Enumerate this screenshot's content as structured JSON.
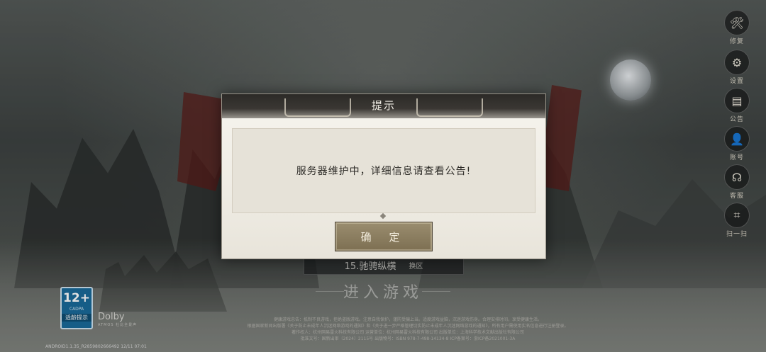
{
  "dialog": {
    "title": "提示",
    "message": "服务器维护中，详细信息请查看公告!",
    "confirm_label": "确 定"
  },
  "side_menu": [
    {
      "icon": "wrench-icon",
      "glyph": "🛠",
      "label": "修复"
    },
    {
      "icon": "gear-icon",
      "glyph": "⚙",
      "label": "设置"
    },
    {
      "icon": "notice-icon",
      "glyph": "▤",
      "label": "公告"
    },
    {
      "icon": "user-icon",
      "glyph": "👤",
      "label": "账号"
    },
    {
      "icon": "headset-icon",
      "glyph": "☊",
      "label": "客服"
    },
    {
      "icon": "scan-icon",
      "glyph": "⌗",
      "label": "扫一扫"
    }
  ],
  "server": {
    "name": "15.驰骋纵横",
    "switch_label": "换区"
  },
  "enter_game_label": "进入游戏",
  "rating": {
    "age": "12+",
    "org": "CADPA",
    "tip": "适龄提示"
  },
  "dolby": {
    "brand": "Dolby",
    "sub": "ATMOS 杜比全景声"
  },
  "legal_text": [
    "健康游戏忠告：抵制不良游戏，拒绝盗版游戏。注意自我保护，谨防受骗上当。适度游戏益脑，沉迷游戏伤身。合理安排时间，享受健康生活。",
    "根据国家新闻出版署《关于防止未成年人沉迷网络游戏的通知》和《关于进一步严格管理切实防止未成年人沉迷网络游戏的通知》，所有用户需使用实名信息进行注册登录。",
    "著作权人：杭州网易雷火科技有限公司  运营单位：杭州网易雷火科技有限公司  出版单位：上海科学技术文献出版社有限公司",
    "批准文号：国新出审〔2024〕2115号  出版物号：ISBN 978-7-498-14134-8  ICP备案号：浙ICP备2021001-3A"
  ],
  "version": "ANDROID1.1.35_R2859802666492 12/11 07:01"
}
